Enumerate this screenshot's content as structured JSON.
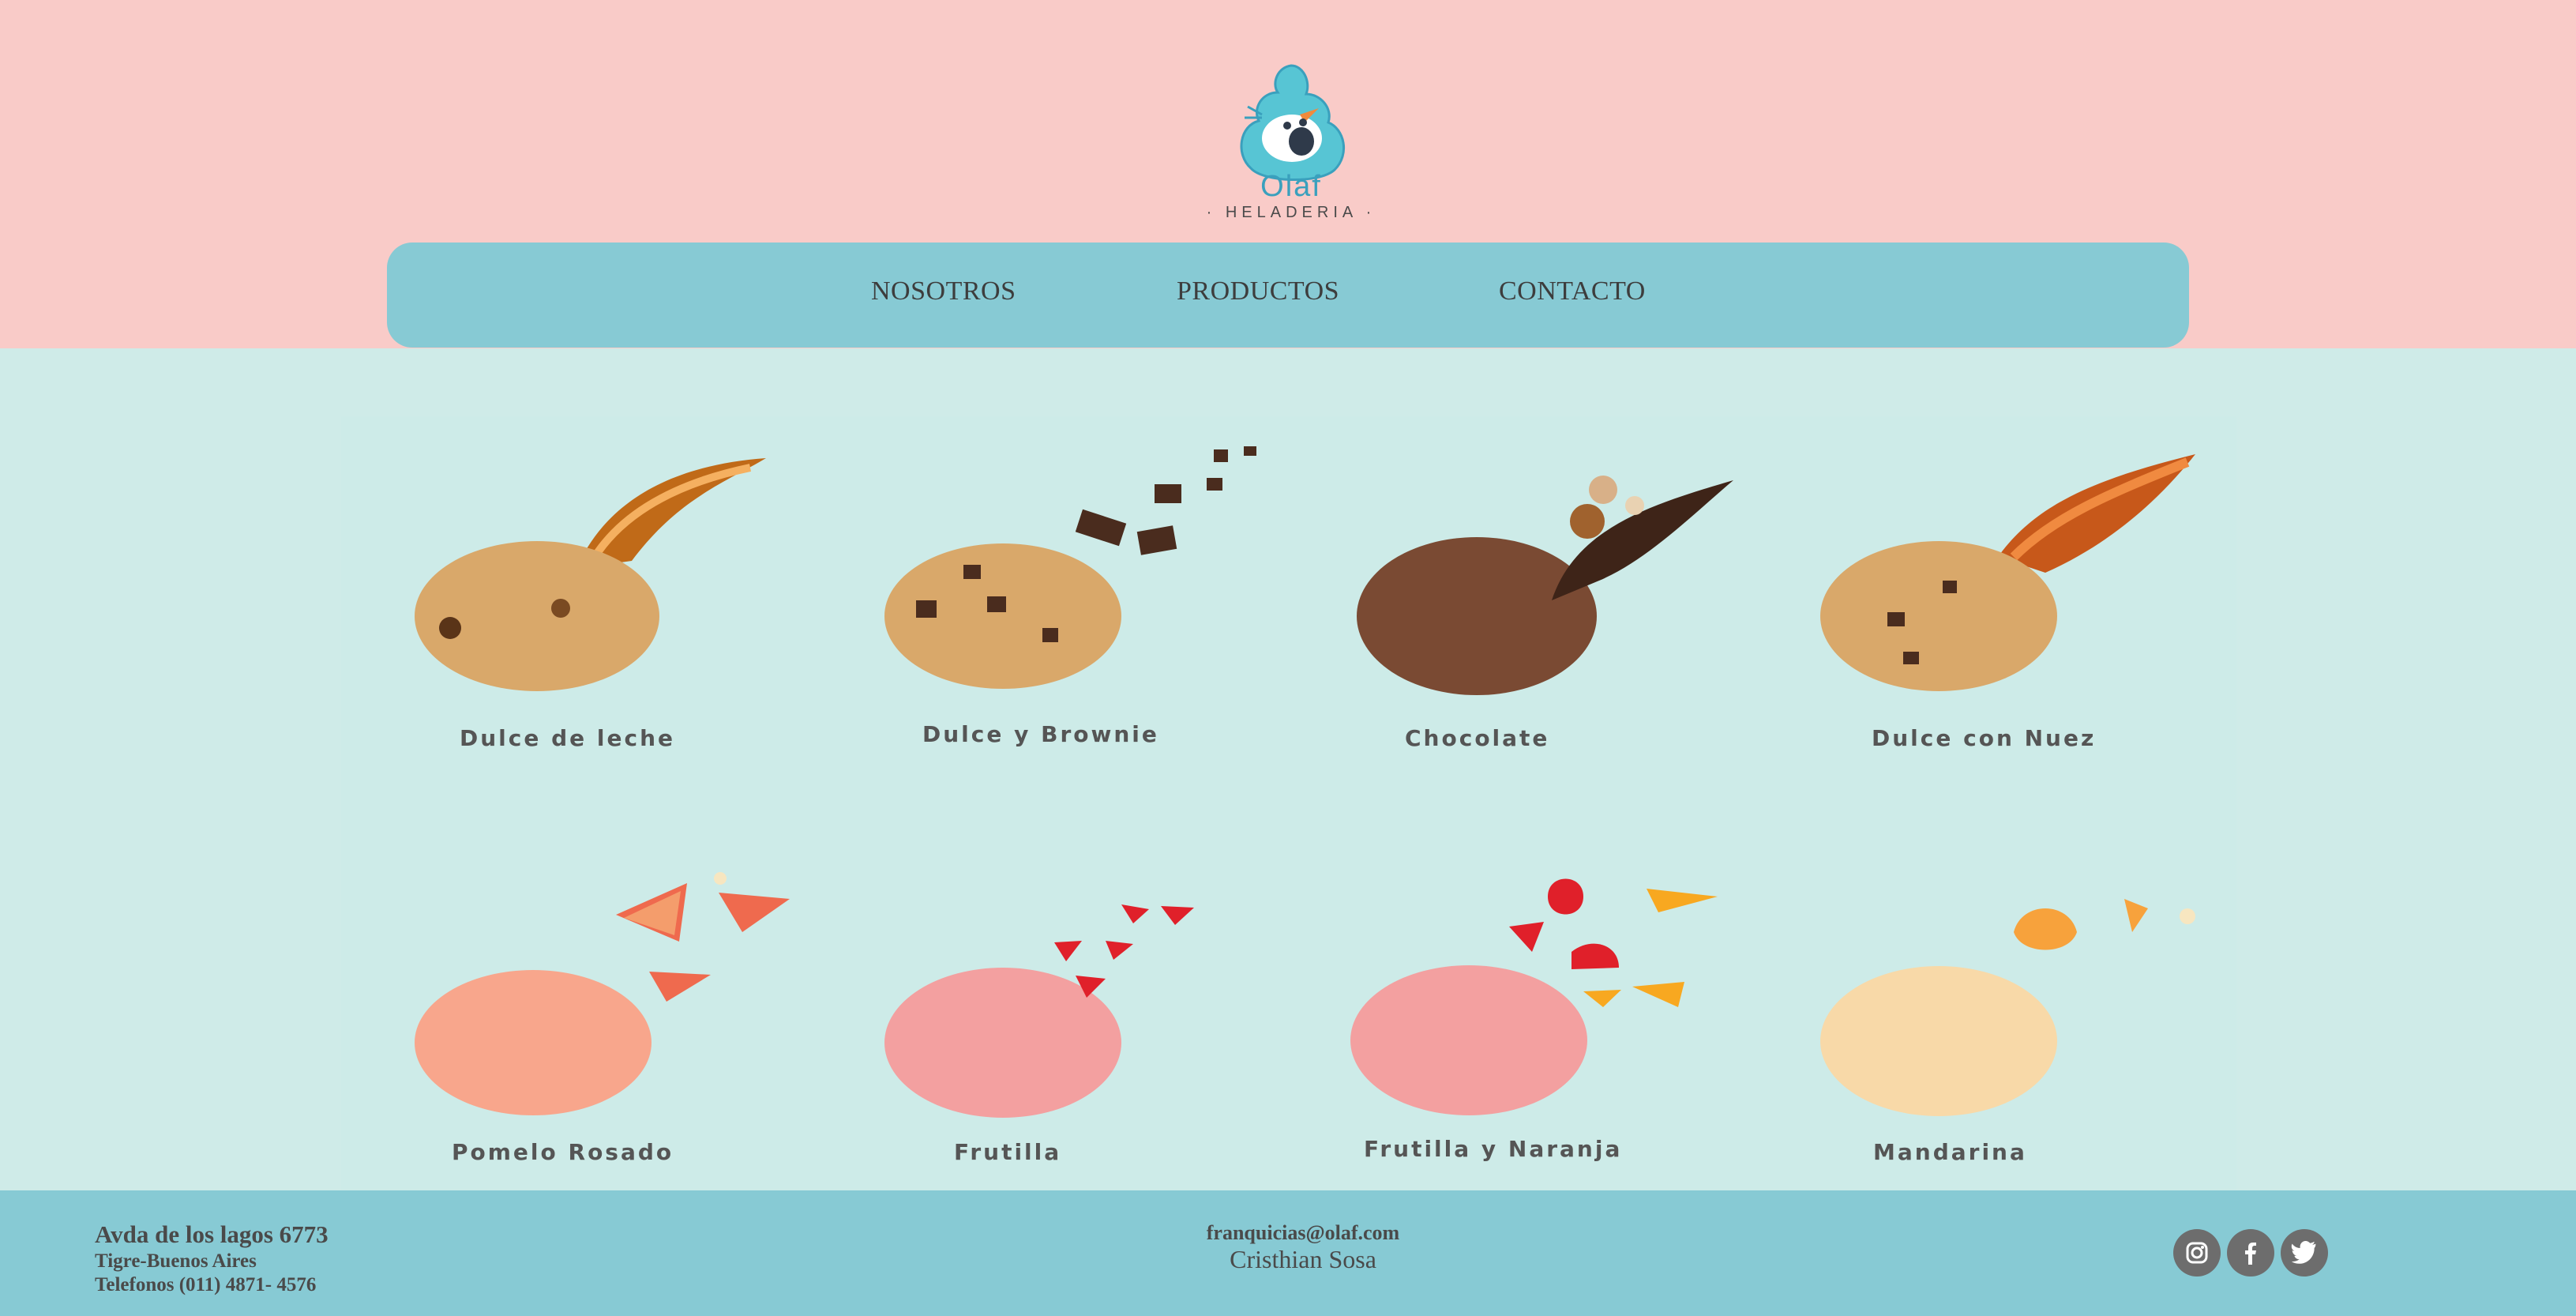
{
  "brand": {
    "name": "Olaf",
    "subtitle": "HELADERIA"
  },
  "nav": {
    "items": [
      "NOSOTROS",
      "PRODUCTOS",
      "CONTACTO"
    ]
  },
  "products": [
    {
      "label": "Dulce de leche"
    },
    {
      "label": "Dulce y Brownie"
    },
    {
      "label": "Chocolate"
    },
    {
      "label": "Dulce con Nuez"
    },
    {
      "label": "Pomelo Rosado"
    },
    {
      "label": "Frutilla"
    },
    {
      "label": "Frutilla y Naranja"
    },
    {
      "label": "Mandarina"
    }
  ],
  "footer": {
    "address_line1": "Avda de los lagos 6773",
    "address_line2": "Tigre-Buenos Aires",
    "address_line3": "Telefonos (011) 4871- 4576",
    "email": "franquicias@olaf.com",
    "contact_name": "Cristhian Sosa"
  },
  "social": [
    "instagram-icon",
    "facebook-icon",
    "twitter-icon"
  ],
  "colors": {
    "header_bg": "#f9cbc8",
    "nav_bg": "#87cad4",
    "page_bg": "#cfebe8",
    "footer_bg": "#87cad4"
  }
}
